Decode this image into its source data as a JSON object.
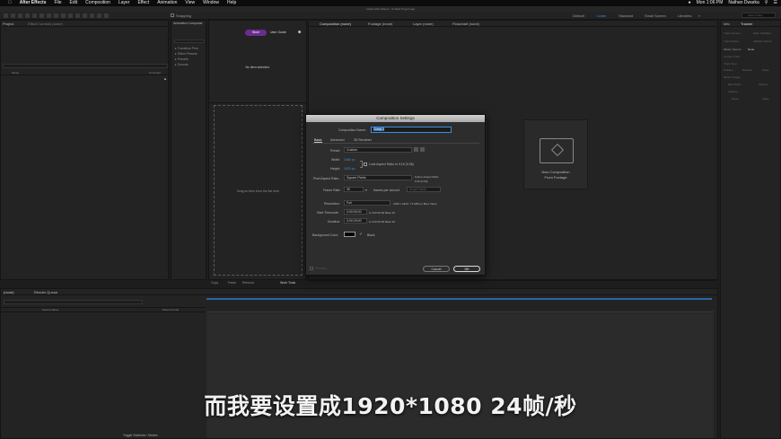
{
  "menubar": {
    "apple_icon": "apple-icon",
    "app_name": "After Effects",
    "items": [
      "File",
      "Edit",
      "Composition",
      "Layer",
      "Effect",
      "Animation",
      "View",
      "Window",
      "Help"
    ],
    "clock": "Mon 1:06 PM",
    "user": "Nathan Dwarka"
  },
  "titlebar": {
    "text": "Adobe After Effects - Untitled Project.aep"
  },
  "toolbar": {
    "snapping": "Snapping",
    "workspaces": [
      "Default",
      "Learn",
      "Standard",
      "Small Screen",
      "Libraries"
    ],
    "active_workspace": "Learn",
    "search_placeholder": "Search Help"
  },
  "project_panel": {
    "tab_project": "Project",
    "tab_effect_controls": "Effect Controls (none)",
    "col_name": "Name",
    "col_comment": "Comment"
  },
  "tree_panel": {
    "tab": "Animation Composer",
    "items": [
      "Transition Pres",
      "Effect Presets",
      "Presets",
      "Sounds"
    ]
  },
  "flow_panel": {
    "store": "Store",
    "user_guide": "User Guide",
    "no_item": "No item selected.",
    "drop_hint": "Drag an item from the list here",
    "footer_copy": "Copy",
    "footer_paste": "Paste",
    "footer_remove": "Remove",
    "footer_tools": "Work Tools"
  },
  "comp_panel": {
    "tab_comp": "Composition (none)",
    "tab_footage": "Footage (none)",
    "tab_layer": "Layer (none)",
    "tab_flowchart": "Flowchart (none)",
    "new_from_footage": [
      "New Composition",
      "From Footage"
    ]
  },
  "dialog": {
    "title": "Composition Settings",
    "name_label": "Composition Name:",
    "name_value": "Comp 1",
    "tabs": [
      "Basic",
      "Advanced",
      "3D Renderer"
    ],
    "preset_label": "Preset:",
    "preset_value": "Custom",
    "width_label": "Width:",
    "width_value": "1080 px",
    "height_label": "Height:",
    "height_value": "1920 px",
    "lock_label": "Lock Aspect Ratio to 9:16 (0.56)",
    "par_label": "Pixel Aspect Ratio:",
    "par_value": "Square Pixels",
    "frame_aspect_label": "Frame Aspect Ratio:",
    "frame_aspect_value": "9:16 (0.56)",
    "fps_label": "Frame Rate:",
    "fps_value": "30",
    "fps_unit": "frames per second",
    "fps_drop": "Drop Frame",
    "res_label": "Resolution:",
    "res_value": "Full",
    "res_info": "1080 x 1920, 7.9 MB per 8bpc frame",
    "start_label": "Start Timecode:",
    "start_value": "0:00:00:00",
    "start_info": "is 0:00:00:00  Base 30",
    "dur_label": "Duration:",
    "dur_value": "0:00:29:00",
    "dur_info": "is 0:00:29:00  Base 30",
    "bg_label": "Background Color:",
    "bg_name": "Black",
    "bg_color": "#000000",
    "preview": "Preview",
    "cancel": "Cancel",
    "ok": "OK"
  },
  "right_panel": {
    "tab_info": "Info",
    "tab_tracker": "Tracker",
    "rows": [
      "Track Camera",
      "Warp Stabilizer",
      "Track Motion",
      "Stabilize Motion",
      "Motion Source:",
      "Current Track:",
      "Track Type:",
      "Position",
      "Rotation",
      "Scale",
      "Motion Target:",
      "Edit Target...",
      "Options...",
      "Analyze:",
      "Reset",
      "Apply"
    ],
    "motion_source_value": "None"
  },
  "timeline": {
    "tab_none": "(none)",
    "tab_render": "Render Queue",
    "col_source": "Source Name",
    "col_parent": "Parent & Link",
    "footer": "Toggle Switches / Modes"
  },
  "subtitle": "而我要设置成1920*1080 24帧/秒",
  "colors": {
    "accent": "#3b8de0",
    "store": "#6b2c8f",
    "panel": "#232323"
  }
}
